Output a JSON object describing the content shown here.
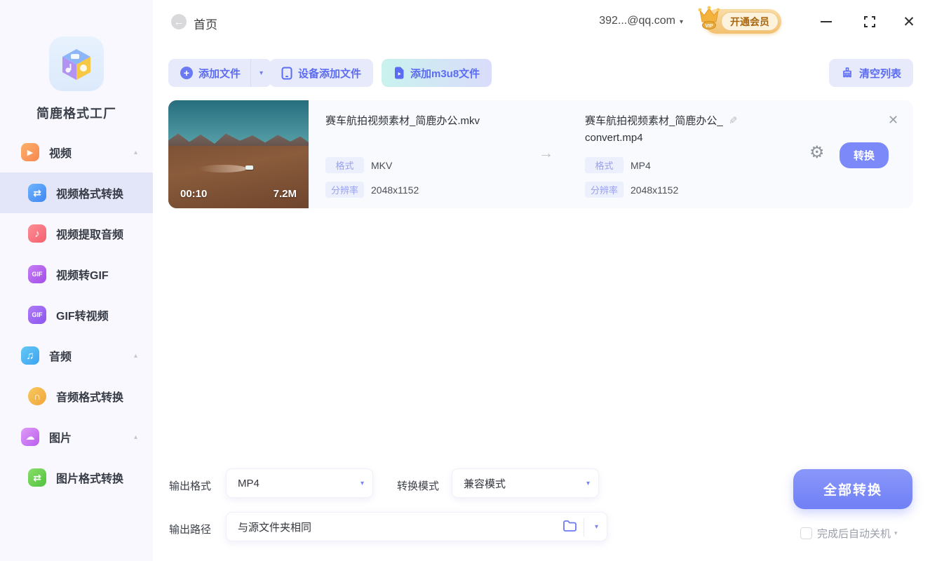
{
  "app": {
    "name": "简鹿格式工厂"
  },
  "header": {
    "back_label": "首页",
    "account": "392...@qq.com",
    "vip_label": "开通会员",
    "vip_tag": "VIP"
  },
  "toolbar": {
    "add_file": "添加文件",
    "device_add": "设备添加文件",
    "add_m3u8": "添加m3u8文件",
    "clear_list": "清空列表"
  },
  "sidebar": {
    "items": [
      {
        "label": "视频",
        "icon": "video-icon",
        "type": "group",
        "active": false
      },
      {
        "label": "视频格式转换",
        "icon": "video-convert-icon",
        "type": "sub",
        "active": true
      },
      {
        "label": "视频提取音频",
        "icon": "extract-audio-icon",
        "type": "sub",
        "active": false
      },
      {
        "label": "视频转GIF",
        "icon": "video-to-gif-icon",
        "type": "sub",
        "active": false
      },
      {
        "label": "GIF转视频",
        "icon": "gif-to-video-icon",
        "type": "sub",
        "active": false
      },
      {
        "label": "音频",
        "icon": "audio-icon",
        "type": "group",
        "active": false
      },
      {
        "label": "音频格式转换",
        "icon": "audio-convert-icon",
        "type": "sub",
        "active": false
      },
      {
        "label": "图片",
        "icon": "image-icon",
        "type": "group",
        "active": false
      },
      {
        "label": "图片格式转换",
        "icon": "image-convert-icon",
        "type": "sub",
        "active": false
      }
    ]
  },
  "file": {
    "duration": "00:10",
    "size": "7.2M",
    "source": {
      "name": "赛车航拍视频素材_简鹿办公.mkv",
      "format_label": "格式",
      "format": "MKV",
      "resolution_label": "分辨率",
      "resolution": "2048x1152"
    },
    "output": {
      "name_line1": "赛车航拍视频素材_简鹿办公_",
      "name_line2": "convert.mp4",
      "format_label": "格式",
      "format": "MP4",
      "resolution_label": "分辨率",
      "resolution": "2048x1152"
    },
    "convert_label": "转换"
  },
  "footer": {
    "output_format_label": "输出格式",
    "output_format_value": "MP4",
    "convert_mode_label": "转换模式",
    "convert_mode_value": "兼容模式",
    "output_path_label": "输出路径",
    "output_path_value": "与源文件夹相同",
    "convert_all_label": "全部转换",
    "shutdown_label": "完成后自动关机"
  },
  "icons": {
    "back": "←",
    "caret_down": "▾",
    "caret_up": "▴",
    "plus": "+",
    "video": "▶",
    "video_convert": "⇄",
    "extract_audio": "♪",
    "gif": "GIF",
    "audio": "♫",
    "audio_convert": "∩",
    "image": "☁",
    "image_convert": "⇄",
    "arrow_right": "→",
    "pencil": "✎",
    "gear": "⚙",
    "close": "✕",
    "minus": "—"
  },
  "colors": {
    "accent": "#6b7af3",
    "accent_button": "#7b8af8",
    "sidebar_bg": "#f8f8fe",
    "active_item_bg": "#e3e6f8",
    "toolbar_btn_bg": "#e7eafb",
    "card_bg": "#f9fafd",
    "badge_bg": "#eceffc",
    "badge_text": "#97a1f4",
    "vip_text": "#a8650f"
  }
}
